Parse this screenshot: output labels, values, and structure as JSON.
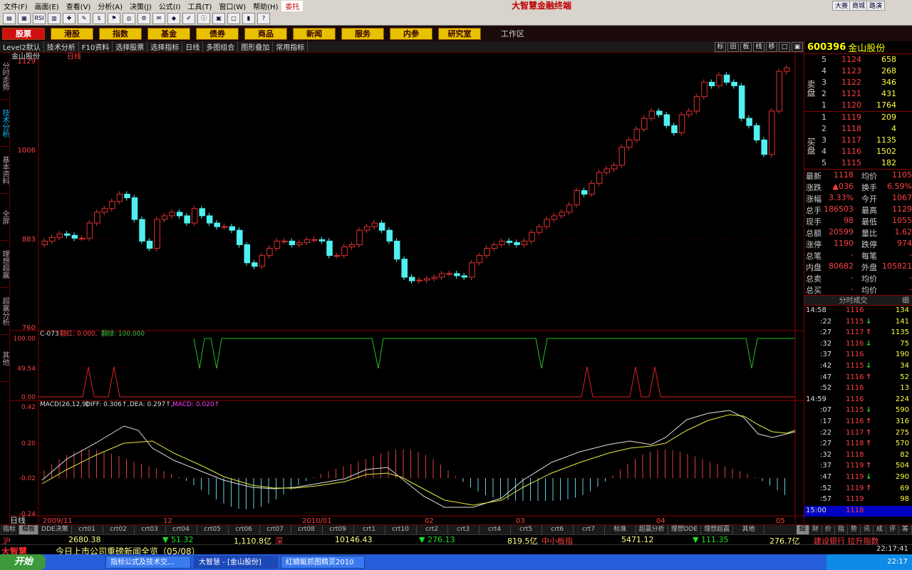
{
  "menu": {
    "items": [
      "文件(F)",
      "画面(E)",
      "查看(V)",
      "分析(A)",
      "决策(J)",
      "公式(I)",
      "工具(T)",
      "窗口(W)",
      "帮助(H)"
    ],
    "brand_tag": "委托",
    "brand": "大智慧金融终端",
    "right_buttons": [
      "大赛",
      "商城",
      "路演"
    ]
  },
  "toolbar_icons": [
    "chart-icon",
    "image-icon",
    "rsi-icon",
    "bar-icon",
    "crosshair-icon",
    "pencil-icon",
    "dollar-icon",
    "flag-icon",
    "binoculars-icon",
    "tool-icon",
    "mail-icon",
    "tag-icon",
    "edit-icon",
    "info-icon",
    "calc-icon",
    "calendar-icon",
    "bars-icon",
    "help-icon"
  ],
  "nav": {
    "buttons": [
      "股票",
      "港股",
      "指数",
      "基金",
      "债券",
      "商品",
      "新闻",
      "服务",
      "内参",
      "研究室"
    ],
    "work": "工作区"
  },
  "subbar": {
    "items": [
      "Level2默认",
      "技术分析",
      "F10资料",
      "选择股票",
      "选择指标",
      "日线",
      "多图组合",
      "图形叠加",
      "常用指标"
    ],
    "right": [
      "标",
      "田",
      "板",
      "线",
      "移",
      "□",
      "▣"
    ]
  },
  "left_tabs": [
    "分时走势",
    "技术分析",
    "基本资料",
    "全屏",
    "理想超赢",
    "超赢分析",
    "其他"
  ],
  "chart": {
    "stock_label": "金山股份",
    "period": "日线",
    "price_ticks": [
      "1129",
      "1006",
      "883",
      "760"
    ],
    "indicator1": {
      "name": "C-073",
      "a_label": "翻红: 0.000,",
      "b_label": "翻绿: 100.000",
      "ticks": [
        "100.00",
        "49.54",
        "0.00"
      ]
    },
    "macd": {
      "label": "MACD(26,12,9)",
      "diff": "DIFF: 0.306↑,",
      "dea": "DEA: 0.297↑,",
      "macd": "MACD: 0.020↑",
      "ticks": [
        "0.42",
        "0.20",
        "-0.02",
        "-0.24"
      ]
    },
    "x_labels": [
      "2009/11",
      "12",
      "2010/01",
      "02",
      "03",
      "04",
      "05"
    ],
    "period_badge": "日线"
  },
  "chart_data": {
    "type": "candlestick",
    "ylim": [
      760,
      1129
    ],
    "note": "daily K-line 金山股份",
    "close": [
      880,
      885,
      890,
      888,
      884,
      884,
      905,
      920,
      925,
      935,
      945,
      940,
      910,
      880,
      870,
      910,
      915,
      920,
      915,
      905,
      925,
      915,
      905,
      900,
      900,
      895,
      875,
      850,
      845,
      860,
      870,
      880,
      880,
      875,
      878,
      882,
      882,
      880,
      860,
      860,
      872,
      875,
      895,
      900,
      905,
      895,
      880,
      855,
      830,
      825,
      826,
      828,
      830,
      835,
      835,
      832,
      830,
      850,
      860,
      870,
      875,
      880,
      878,
      875,
      880,
      892,
      900,
      910,
      915,
      920,
      930,
      950,
      945,
      960,
      975,
      980,
      985,
      1010,
      1020,
      1035,
      1050,
      1060,
      1055,
      1040,
      1030,
      1055,
      1060,
      1080,
      1100,
      1095,
      1110,
      1100,
      1095,
      1050,
      1040,
      1020,
      1000,
      1060,
      1115,
      1120
    ]
  },
  "quote": {
    "code": "600396",
    "name": "金山股份",
    "sell_label": "卖盘",
    "buy_label": "买盘",
    "sell": [
      [
        "5",
        "1124",
        "658"
      ],
      [
        "4",
        "1123",
        "268"
      ],
      [
        "3",
        "1122",
        "346"
      ],
      [
        "2",
        "1121",
        "431"
      ],
      [
        "1",
        "1120",
        "1764"
      ]
    ],
    "buy": [
      [
        "1",
        "1119",
        "209"
      ],
      [
        "2",
        "1118",
        "4"
      ],
      [
        "3",
        "1117",
        "1135"
      ],
      [
        "4",
        "1116",
        "1502"
      ],
      [
        "5",
        "1115",
        "182"
      ]
    ],
    "stats": [
      [
        "最新",
        "1118",
        "均价",
        "1105"
      ],
      [
        "涨跌",
        "▲036",
        "换手",
        "6.59%"
      ],
      [
        "涨幅",
        "3.33%",
        "今开",
        "1067"
      ],
      [
        "总手",
        "186503",
        "最高",
        "1129"
      ],
      [
        "现手",
        "98",
        "最低",
        "1055"
      ],
      [
        "总额",
        "20599",
        "量比",
        "1.62"
      ],
      [
        "涨停",
        "1190",
        "跌停",
        "974"
      ],
      [
        "总笔",
        "-",
        "每笔",
        "-"
      ],
      [
        "内盘",
        "80682",
        "外盘",
        "105821"
      ],
      [
        "总卖",
        "-",
        "均价",
        "-"
      ],
      [
        "总买",
        "-",
        "均价",
        "-"
      ]
    ],
    "trades_title": "分时成交",
    "trades_tab": "细",
    "trades": [
      [
        "14:58",
        "1116",
        "134",
        ""
      ],
      [
        ":22",
        "1115",
        "141",
        "down"
      ],
      [
        ":27",
        "1117",
        "1135",
        "up"
      ],
      [
        ":32",
        "1116",
        "75",
        "down"
      ],
      [
        ":37",
        "1116",
        "190",
        ""
      ],
      [
        ":42",
        "1115",
        "34",
        "down"
      ],
      [
        ":47",
        "1116",
        "52",
        "up"
      ],
      [
        ":52",
        "1116",
        "13",
        ""
      ],
      [
        "14:59",
        "1116",
        "224",
        ""
      ],
      [
        ":07",
        "1115",
        "590",
        "down"
      ],
      [
        ":17",
        "1116",
        "316",
        "up"
      ],
      [
        ":22",
        "1117",
        "275",
        "up"
      ],
      [
        ":27",
        "1118",
        "570",
        "up"
      ],
      [
        ":32",
        "1118",
        "82",
        ""
      ],
      [
        ":37",
        "1119",
        "504",
        "up"
      ],
      [
        ":47",
        "1119",
        "290",
        "down"
      ],
      [
        ":52",
        "1119",
        "69",
        "up"
      ],
      [
        ":57",
        "1119",
        "98",
        ""
      ],
      [
        "15:00",
        "1118",
        "",
        ""
      ]
    ]
  },
  "bottom_tabs": [
    "指标",
    "模板",
    "DDE决策",
    "crt01",
    "crt02",
    "crt03",
    "crt04",
    "crt05",
    "crt06",
    "crt07",
    "crt08",
    "crt09",
    "crt1",
    "crt10",
    "crt2",
    "crt3",
    "crt4",
    "crt5",
    "crt6",
    "crt7",
    "标准",
    "超赢分析",
    "理想DDE",
    "理想超赢",
    "其他"
  ],
  "bottom_right_tabs": [
    "细",
    "财",
    "价",
    "指",
    "势",
    "讯",
    "成",
    "评",
    "筹"
  ],
  "index_bar": {
    "sh_label": "沪",
    "sh_val": "2680.38",
    "sh_chg": "▼ 51.32",
    "sh_amt": "1,110.8亿",
    "sz_label": "深",
    "sz_val": "10146.43",
    "sz_chg": "▼ 276.13",
    "sz_amt": "819.5亿",
    "zx_label": "中小板指",
    "zx_val": "5471.12",
    "zx_chg": "▼ 111.35",
    "zx_amt": "276.7亿",
    "alert": "建设银行 拉升指数"
  },
  "news": {
    "brand": "大智慧",
    "text": "今日上市公司重磅新闻全览（05/08）",
    "time": "22:17:41"
  },
  "taskbar": {
    "start": "开始",
    "tasks": [
      "指标公式及技术交...",
      "大智慧 - [金山股份]",
      "红蜻蜓抓图精灵2010"
    ],
    "clock": "22:17"
  }
}
